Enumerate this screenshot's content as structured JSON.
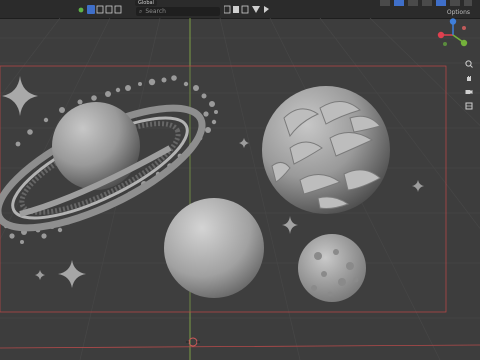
{
  "header": {
    "transform_orientation": "Global",
    "search_placeholder": "Search",
    "options_label": "Options"
  },
  "gizmo": {
    "axes": [
      "X",
      "Y",
      "Z"
    ],
    "axis_colors": {
      "x": "#e0404f",
      "y": "#74b13b",
      "z": "#3f7fdb"
    }
  },
  "viewport": {
    "background": "#3d3d3d",
    "grid_color": "#474747",
    "camera_frame_color": "#c04848",
    "y_axis_line_color": "#8ab547",
    "x_axis_line_color": "#b34a4a"
  },
  "scene": {
    "objects": [
      "ringed-planet",
      "plain-sphere",
      "lumpy-planet",
      "small-cratered-moon",
      "star-sparkle-large",
      "star-sparkle-small",
      "star-sparkle-tiny"
    ]
  }
}
